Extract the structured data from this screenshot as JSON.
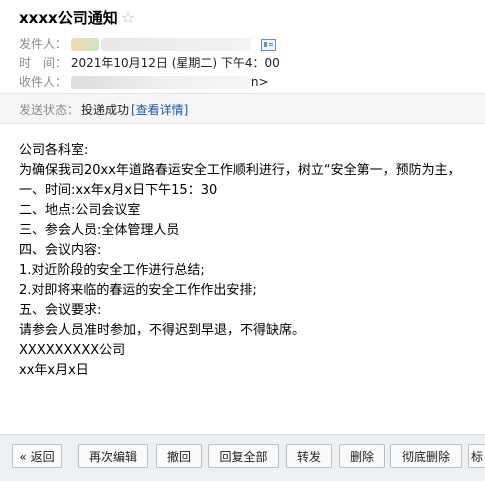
{
  "email": {
    "subject": "xxxx公司通知",
    "sender_label": "发件人：",
    "time_label": "时　间：",
    "time_value": "2021年10月12日 (星期二) 下午4：00",
    "recipient_label": "收件人：",
    "recipient_suffix": "n>",
    "status_label": "发送状态：",
    "status_value": "投递成功",
    "status_link": "[查看详情]"
  },
  "body_lines": [
    "公司各科室:",
    "为确保我司20xx年道路春运安全工作顺利进行，树立“安全第一，预防为主，",
    "一、时间:xx年x月x日下午15：30",
    "二、地点:公司会议室",
    "三、参会人员:全体管理人员",
    "四、会议内容:",
    "1.对近阶段的安全工作进行总结;",
    "2.对即将来临的春运的安全工作作出安排;",
    "五、会议要求:",
    "请参会人员准时参加，不得迟到早退，不得缺席。",
    "XXXXXXXXX公司",
    "xx年x月x日"
  ],
  "toolbar": {
    "back": "« 返回",
    "edit_again": "再次编辑",
    "recall": "撤回",
    "reply_all": "回复全部",
    "forward": "转发",
    "delete": "删除",
    "delete_permanently": "彻底删除",
    "more": "标"
  }
}
